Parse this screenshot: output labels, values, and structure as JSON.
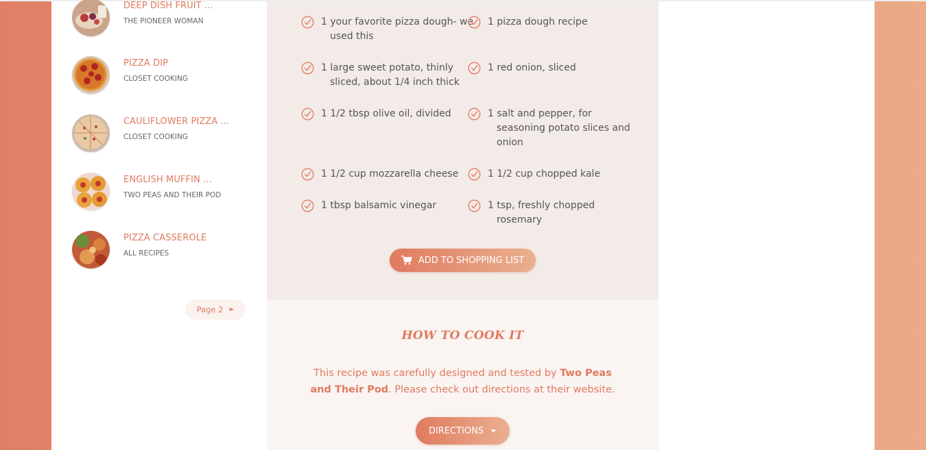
{
  "related_recipes": [
    {
      "title": "DEEP DISH FRUIT ...",
      "source": "THE PIONEER WOMAN"
    },
    {
      "title": "PIZZA DIP",
      "source": "CLOSET COOKING"
    },
    {
      "title": "CAULIFLOWER PIZZA ...",
      "source": "CLOSET COOKING"
    },
    {
      "title": "ENGLISH MUFFIN ...",
      "source": "TWO PEAS AND THEIR POD"
    },
    {
      "title": "PIZZA CASSEROLE",
      "source": "ALL RECIPES"
    }
  ],
  "pagination": {
    "label": "Page 2",
    "arrow": "►"
  },
  "ingredients": [
    {
      "qty": "1",
      "text": "your favorite pizza dough- we used this"
    },
    {
      "qty": "1",
      "text": "pizza dough recipe"
    },
    {
      "qty": "1",
      "text": "large sweet potato, thinly sliced, about 1/4 inch thick"
    },
    {
      "qty": "1",
      "text": "red onion, sliced"
    },
    {
      "qty": "1 1/2",
      "text": "tbsp olive oil, divided"
    },
    {
      "qty": "1",
      "text": "salt and pepper, for seasoning potato slices and onion"
    },
    {
      "qty": "1 1/2",
      "text": "cup mozzarella cheese"
    },
    {
      "qty": "1 1/2",
      "text": "cup chopped kale"
    },
    {
      "qty": "1",
      "text": "tbsp balsamic vinegar"
    },
    {
      "qty": "1",
      "text": "tsp, freshly chopped rosemary"
    }
  ],
  "shopping": {
    "label": "ADD TO SHOPPING LIST",
    "icon": "cart-icon"
  },
  "how_to": {
    "title": "HOW TO COOK IT",
    "text_before": "This recipe was carefully designed and tested by ",
    "author": "Two Peas and Their Pod",
    "text_after": ". Please check out directions at their website.",
    "button_label": "DIRECTIONS",
    "button_arrow": "►"
  },
  "colors": {
    "accent": "#e07a5f",
    "accent_light": "#eab08f",
    "ingredients_bg": "#f3ebe8",
    "howto_bg": "#faf4f2"
  }
}
